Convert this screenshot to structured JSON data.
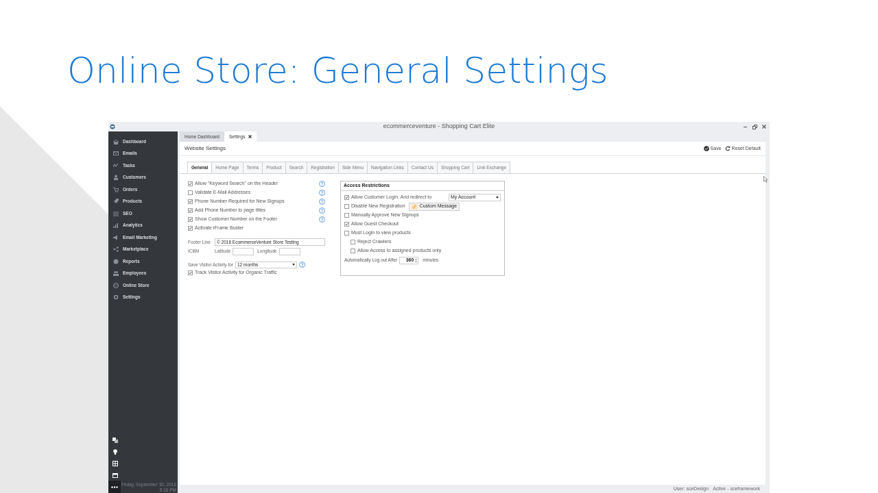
{
  "slide": {
    "title": "Online Store: General Settings"
  },
  "window": {
    "title": "ecommerceventure - Shopping Cart Elite"
  },
  "sidebar": {
    "items": [
      {
        "label": "Dashboard"
      },
      {
        "label": "Emails"
      },
      {
        "label": "Tasks"
      },
      {
        "label": "Customers"
      },
      {
        "label": "Orders"
      },
      {
        "label": "Products"
      },
      {
        "label": "SEO"
      },
      {
        "label": "Analytics"
      },
      {
        "label": "Email Marketing"
      },
      {
        "label": "Marketplace"
      },
      {
        "label": "Reports"
      },
      {
        "label": "Employees"
      },
      {
        "label": "Online Store"
      },
      {
        "label": "Settings"
      }
    ],
    "date": "Friday, September 30, 2016",
    "time": "5:16 PM"
  },
  "doc_tabs": [
    {
      "label": "Home Dashboard",
      "selected": false,
      "closable": false
    },
    {
      "label": "Settings",
      "selected": true,
      "closable": true
    }
  ],
  "header": {
    "title": "Website Settings",
    "actions": [
      {
        "kind": "save",
        "label": "Save"
      },
      {
        "kind": "reset",
        "label": "Reset Default"
      }
    ]
  },
  "settings_tabs": [
    {
      "label": "General",
      "selected": true
    },
    {
      "label": "Home Page",
      "selected": false
    },
    {
      "label": "Terms",
      "selected": false
    },
    {
      "label": "Product",
      "selected": false
    },
    {
      "label": "Search",
      "selected": false
    },
    {
      "label": "Registration",
      "selected": false
    },
    {
      "label": "Side Menu",
      "selected": false
    },
    {
      "label": "Navigation Links",
      "selected": false
    },
    {
      "label": "Contact Us",
      "selected": false
    },
    {
      "label": "Shopping Cart",
      "selected": false
    },
    {
      "label": "Link Exchange",
      "selected": false
    }
  ],
  "general": {
    "options": [
      {
        "label": "Allow \"Keyword Search\" on the Header",
        "checked": true,
        "help": true
      },
      {
        "label": "Validate E-Mail Addresses",
        "checked": false,
        "help": true
      },
      {
        "label": "Phone Number Required for New Signups",
        "checked": true,
        "help": true
      },
      {
        "label": "Add Phone Number to page titles",
        "checked": true,
        "help": true
      },
      {
        "label": "Show Customer Number on the Footer",
        "checked": true,
        "help": true
      },
      {
        "label": "Activate IFrame Buster",
        "checked": true,
        "help": false
      }
    ],
    "footer_line": {
      "label": "Footer Line",
      "value": "© 2016 EcommerceVenture Store Testing"
    },
    "icbm": {
      "label": "ICBM",
      "latitude_label": "Latitude",
      "longitude_label": "Longitude"
    },
    "visitor_activity": {
      "label": "Save Visitor Activity for",
      "value": "12 months"
    },
    "track_organic": {
      "label": "Track Visitor Activity for Organic Traffic",
      "checked": true
    }
  },
  "access_restrictions": {
    "title": "Access Restrictions",
    "items": [
      {
        "kind": "dropdown",
        "label": "Allow Customer Login. And redirect to",
        "checked": true,
        "value": "My Account"
      },
      {
        "kind": "button",
        "label": "Disable New Registration",
        "checked": false,
        "button": "Custom Message"
      },
      {
        "kind": "checkbox",
        "label": "Manually Approve New Signups",
        "checked": false
      },
      {
        "kind": "checkbox",
        "label": "Allow Guest Checkout",
        "checked": true
      },
      {
        "kind": "checkbox",
        "label": "Must Login to view products",
        "checked": false,
        "children": [
          {
            "kind": "checkbox",
            "label": "Reject Crawlers",
            "checked": false
          },
          {
            "kind": "checkbox",
            "label": "Allow Access to assigned products only",
            "checked": false
          }
        ]
      }
    ],
    "logout": {
      "label": "Automatically Log out After",
      "value": "360",
      "unit": "minutes"
    }
  },
  "status_bar": {
    "user": "User: sceDesign",
    "active": "Active - sceframework"
  }
}
